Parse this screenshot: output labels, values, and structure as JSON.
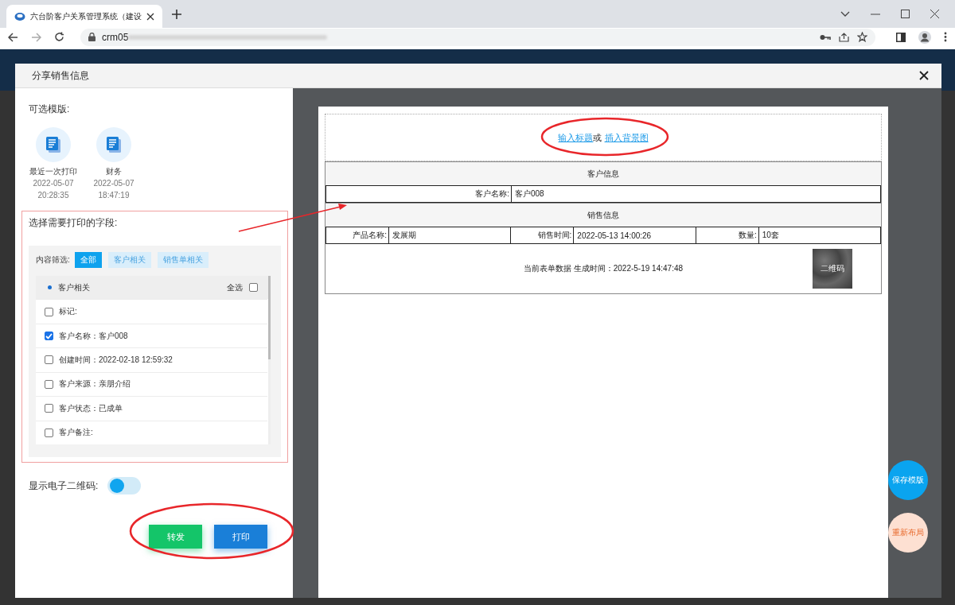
{
  "browser": {
    "tab_title": "六台阶客户关系管理系统（建设",
    "url": "crm05"
  },
  "dialog": {
    "title": "分享销售信息"
  },
  "templates_label": "可选模版:",
  "templates": [
    {
      "name": "最近一次打印",
      "date": "2022-05-07",
      "time": "20:28:35"
    },
    {
      "name": "财务",
      "date": "2022-05-07",
      "time": "18:47:19"
    }
  ],
  "fields": {
    "title": "选择需要打印的字段:",
    "filter_label": "内容筛选:",
    "filters": [
      {
        "label": "全部",
        "selected": true
      },
      {
        "label": "客户相关",
        "selected": false
      },
      {
        "label": "销售单相关",
        "selected": false
      }
    ],
    "group": {
      "label": "客户相关",
      "select_all_label": "全选",
      "select_all_checked": false
    },
    "items": [
      {
        "label": "标记:",
        "checked": false
      },
      {
        "label": "客户名称：客户008",
        "checked": true
      },
      {
        "label": "创建时间：2022-02-18 12:59:32",
        "checked": false
      },
      {
        "label": "客户来源：亲朋介绍",
        "checked": false
      },
      {
        "label": "客户状态：已成单",
        "checked": false
      },
      {
        "label": "客户备注:",
        "checked": false
      }
    ]
  },
  "qr_toggle": {
    "label": "显示电子二维码:",
    "on": false
  },
  "buttons": [
    {
      "label": "转发",
      "kind": "forward"
    },
    {
      "label": "打印",
      "kind": "print"
    }
  ],
  "preview": {
    "title_link": "输入标题",
    "title_or": "或",
    "bg_link": "插入背景图",
    "sections": [
      {
        "heading": "客户信息",
        "rows": [
          [
            {
              "label": "客户名称:",
              "value": "客户008"
            }
          ]
        ]
      },
      {
        "heading": "销售信息",
        "rows": [
          [
            {
              "label": "产品名称:",
              "value": "发展期"
            },
            {
              "label": "销售时间:",
              "value": "2022-05-13 14:00:26"
            },
            {
              "label": "数量:",
              "value": "10套"
            }
          ]
        ]
      }
    ],
    "footer_text": "当前表单数据 生成时间：2022-5-19 14:47:48",
    "qr_label": "二维码"
  },
  "side_buttons": [
    {
      "label": "保存模版",
      "kind": "save"
    },
    {
      "label": "重新布局",
      "kind": "relayout"
    }
  ]
}
